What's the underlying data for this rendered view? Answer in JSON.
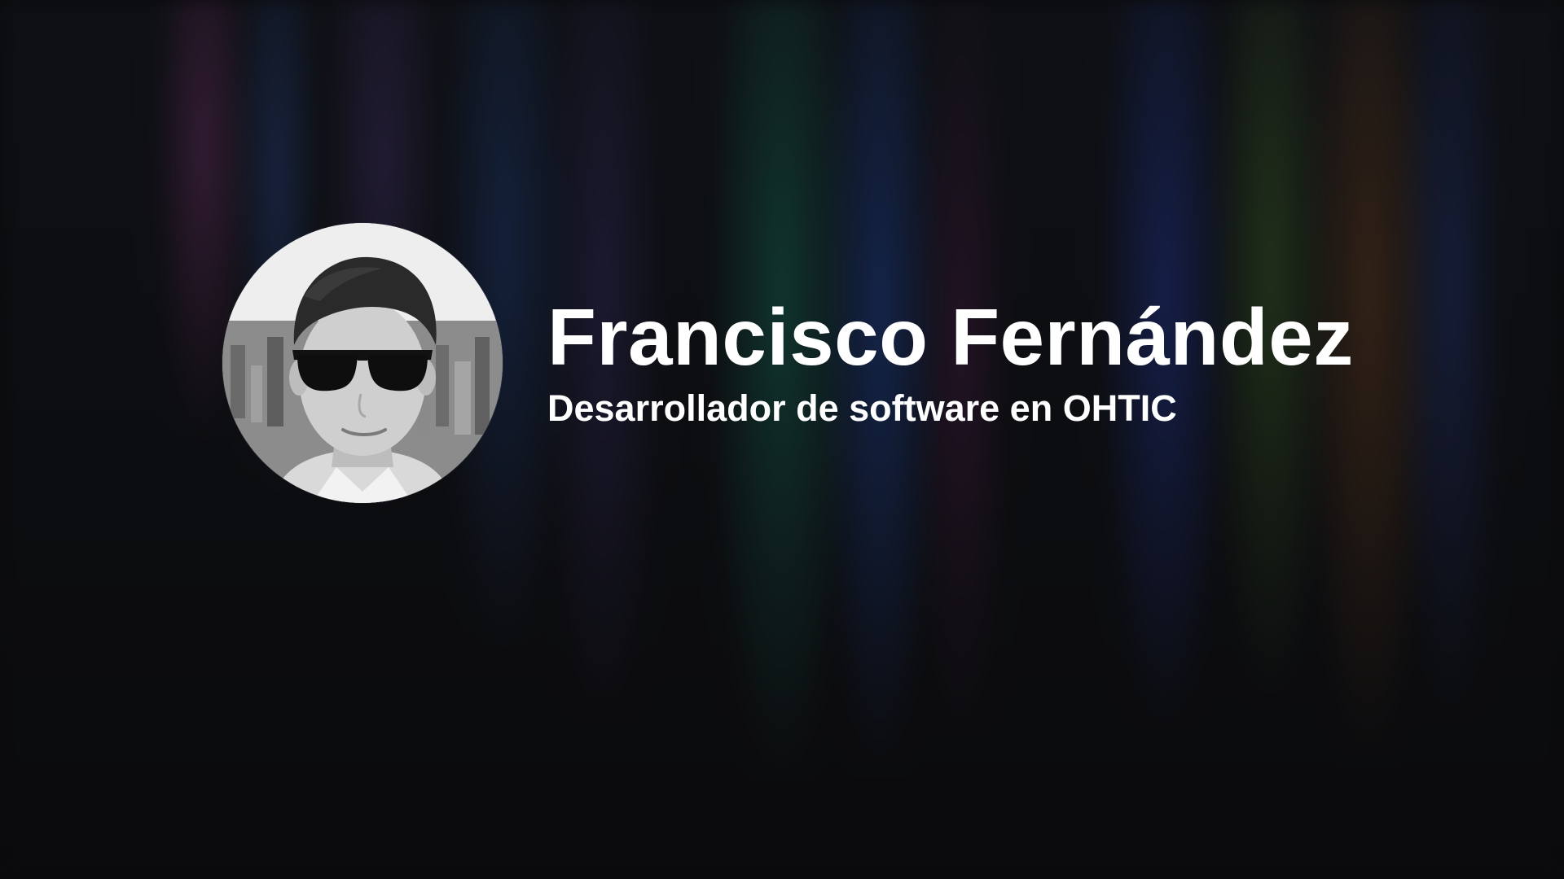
{
  "profile": {
    "name": "Francisco Fernández",
    "role": "Desarrollador de software en OHTIC",
    "avatar_icon": "person-avatar"
  },
  "colors": {
    "background": "#0b0b0d",
    "text": "#ffffff"
  }
}
